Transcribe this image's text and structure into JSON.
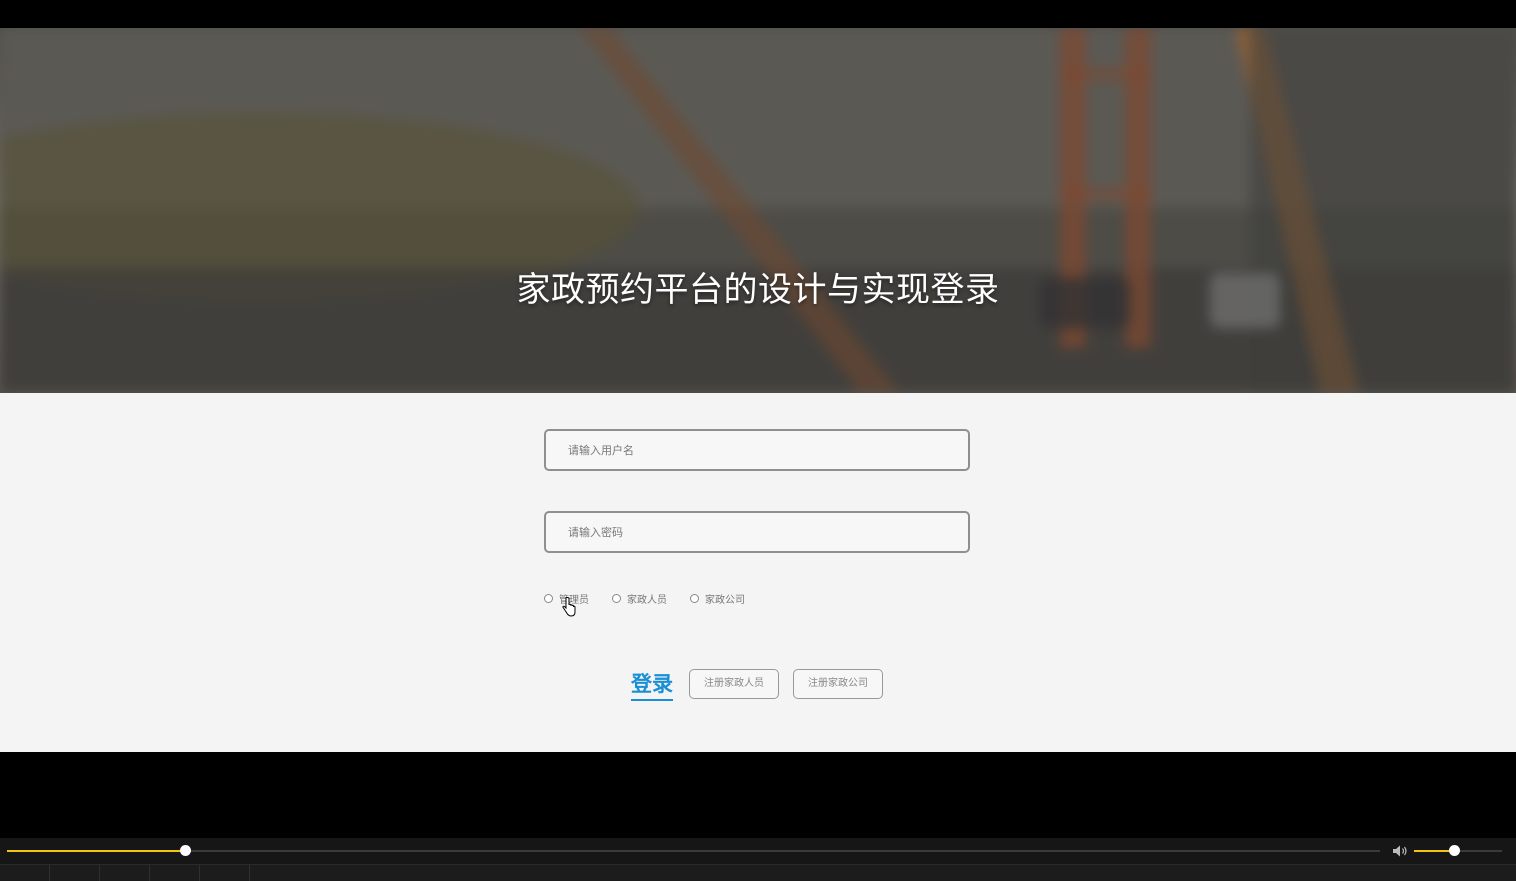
{
  "hero": {
    "title": "家政预约平台的设计与实现登录"
  },
  "form": {
    "username_placeholder": "请输入用户名",
    "password_placeholder": "请输入密码",
    "roles": [
      {
        "label": "管理员",
        "selected": false
      },
      {
        "label": "家政人员",
        "selected": false
      },
      {
        "label": "家政公司",
        "selected": false
      }
    ],
    "login_label": "登录",
    "register_staff_label": "注册家政人员",
    "register_company_label": "注册家政公司"
  },
  "player": {
    "progress": 0.13,
    "volume": 0.45,
    "accent_color": "#f1c40f"
  },
  "colors": {
    "login_accent": "#1a8fd6",
    "form_background": "#f4f4f4"
  }
}
